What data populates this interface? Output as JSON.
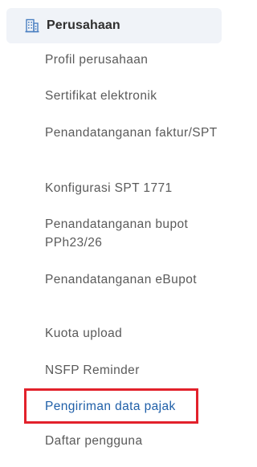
{
  "section": {
    "title": "Perusahaan",
    "icon": "building-icon",
    "accent_color": "#4a7fc1"
  },
  "items": [
    {
      "label": "Profil perusahaan"
    },
    {
      "label": "Sertifikat elektronik"
    },
    {
      "label": "Penandatanganan faktur/SPT"
    },
    {
      "label": "Konfigurasi SPT 1771"
    },
    {
      "label": "Penandatanganan bupot PPh23/26"
    },
    {
      "label": "Penandatanganan eBupot"
    },
    {
      "label": "Kuota upload"
    },
    {
      "label": "NSFP Reminder"
    },
    {
      "label": "Pengiriman data pajak",
      "active": true
    },
    {
      "label": "Daftar pengguna"
    }
  ],
  "highlight_color": "#e2212b",
  "active_color": "#1f5fa8"
}
